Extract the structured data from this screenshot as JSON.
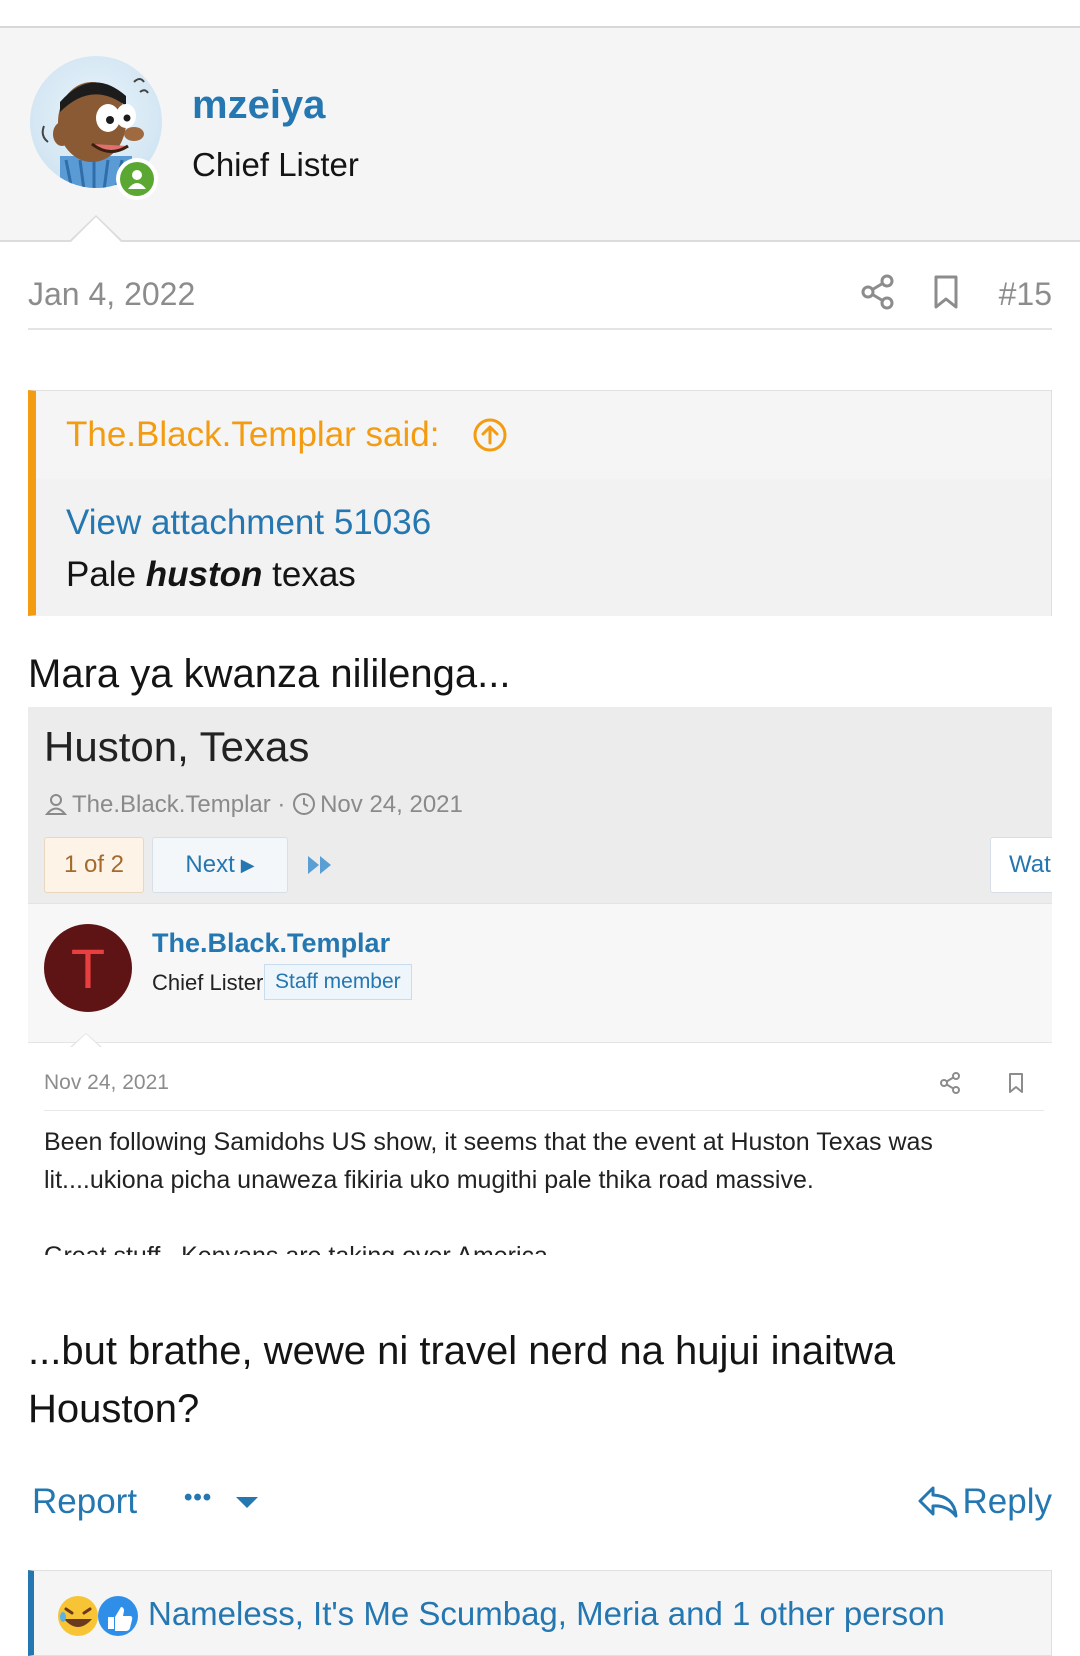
{
  "author": {
    "username": "mzeiya",
    "user_title": "Chief Lister"
  },
  "post": {
    "date": "Jan 4, 2022",
    "number": "#15",
    "quote": {
      "attribution": "The.Black.Templar said:",
      "attachment_link": "View attachment 51036",
      "text_before": "Pale ",
      "text_emphasis": "huston",
      "text_after": " texas"
    },
    "intro_line": "Mara ya kwanza nililenga...",
    "reply_text": "...but brathe, wewe ni travel nerd na hujui inaitwa Houston?"
  },
  "embedded": {
    "thread_title": "Huston, Texas",
    "thread_author": "The.Black.Templar",
    "meta_separator": "·",
    "thread_date": "Nov 24, 2021",
    "pager_current": "1 of 2",
    "pager_next": "Next",
    "watch_label": "Wat",
    "avatar_letter": "T",
    "username": "The.Black.Templar",
    "user_title": "Chief Lister",
    "badge": "Staff member",
    "post_date": "Nov 24, 2021",
    "paragraph_1": "Been following Samidohs US show, it seems that the event at Huston Texas was lit....ukiona picha unaweza fikiria uko mugithi pale thika road massive.",
    "paragraph_2": "Great stuff...Kenyans are taking over America"
  },
  "actions": {
    "report_label": "Report",
    "more_label": "•••",
    "reply_label": "Reply"
  },
  "reactions": {
    "icons": [
      "laugh-reaction-icon",
      "like-reaction-icon"
    ],
    "summary": "Nameless, It's Me Scumbag, Meria and 1 other person"
  },
  "colors": {
    "link": "#2577b1",
    "quote_accent": "#f39c12",
    "online": "#5aa832"
  }
}
